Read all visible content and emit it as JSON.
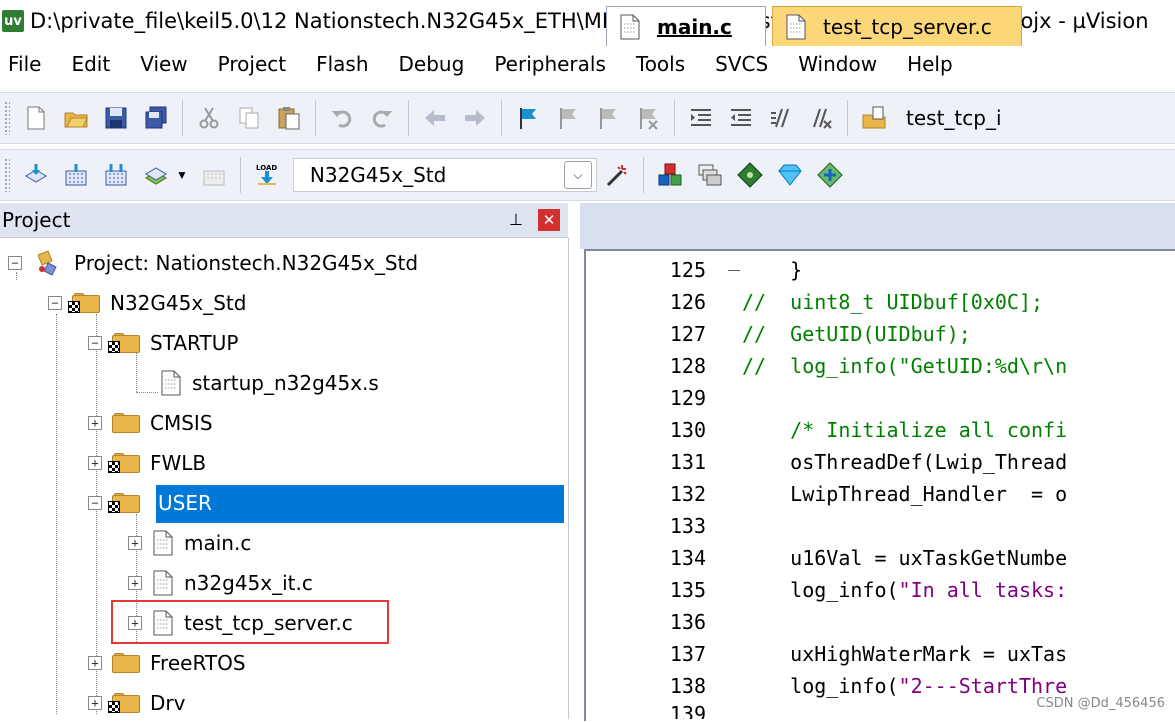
{
  "window": {
    "title": "D:\\private_file\\keil5.0\\12 Nationstech.N32G45x_ETH\\MDK-ARM\\Nationstech.N32G45x_Std.uvprojx - µVision",
    "app_icon": "uv"
  },
  "menu": [
    "File",
    "Edit",
    "View",
    "Project",
    "Flash",
    "Debug",
    "Peripherals",
    "Tools",
    "SVCS",
    "Window",
    "Help"
  ],
  "toolbar1": {
    "find_text": "test_tcp_i"
  },
  "toolbar2": {
    "target": "N32G45x_Std"
  },
  "project_panel": {
    "title": "Project",
    "pin_glyph": "⊥",
    "close_glyph": "✕",
    "tree": {
      "root": "Project: Nationstech.N32G45x_Std",
      "target": "N32G45x_Std",
      "groups": {
        "startup": "STARTUP",
        "startup_file": "startup_n32g45x.s",
        "cmsis": "CMSIS",
        "fwlb": "FWLB",
        "user": "USER",
        "main": "main.c",
        "it": "n32g45x_it.c",
        "tcp": "test_tcp_server.c",
        "freertos": "FreeRTOS",
        "drv": "Drv"
      }
    }
  },
  "editor": {
    "tabs": [
      "main.c",
      "test_tcp_server.c"
    ],
    "lines": [
      {
        "n": "125",
        "text": "    }",
        "cls": "c-normal"
      },
      {
        "n": "126",
        "text": "//  uint8_t UIDbuf[0x0C];",
        "cls": "c-comment"
      },
      {
        "n": "127",
        "text": "//  GetUID(UIDbuf);",
        "cls": "c-comment"
      },
      {
        "n": "128",
        "text": "//  log_info(\"GetUID:%d\\r\\n",
        "cls": "c-comment"
      },
      {
        "n": "129",
        "text": "",
        "cls": "c-normal"
      },
      {
        "n": "130",
        "text": "    /* Initialize all confi",
        "cls": "c-comment"
      },
      {
        "n": "131",
        "text": "    osThreadDef(Lwip_Thread",
        "cls": "c-normal"
      },
      {
        "n": "132",
        "text": "    LwipThread_Handler  = o",
        "cls": "c-normal"
      },
      {
        "n": "133",
        "text": "",
        "cls": "c-normal"
      },
      {
        "n": "134",
        "text": "    u16Val = uxTaskGetNumbe",
        "cls": "c-normal"
      },
      {
        "n": "135a",
        "text": "    log_info(",
        "cls": "c-normal"
      },
      {
        "n": "136",
        "text": "",
        "cls": "c-normal"
      },
      {
        "n": "137",
        "text": "    uxHighWaterMark = uxTas",
        "cls": "c-normal"
      },
      {
        "n": "138a",
        "text": "    log_info(",
        "cls": "c-normal"
      },
      {
        "n": "139",
        "text": "",
        "cls": "c-normal"
      }
    ],
    "line135_string": "\"In all tasks:",
    "line138_string": "\"2---StartThre",
    "line135_num": "135",
    "line138_num": "138"
  },
  "credit": "CSDN @Dd_456456"
}
